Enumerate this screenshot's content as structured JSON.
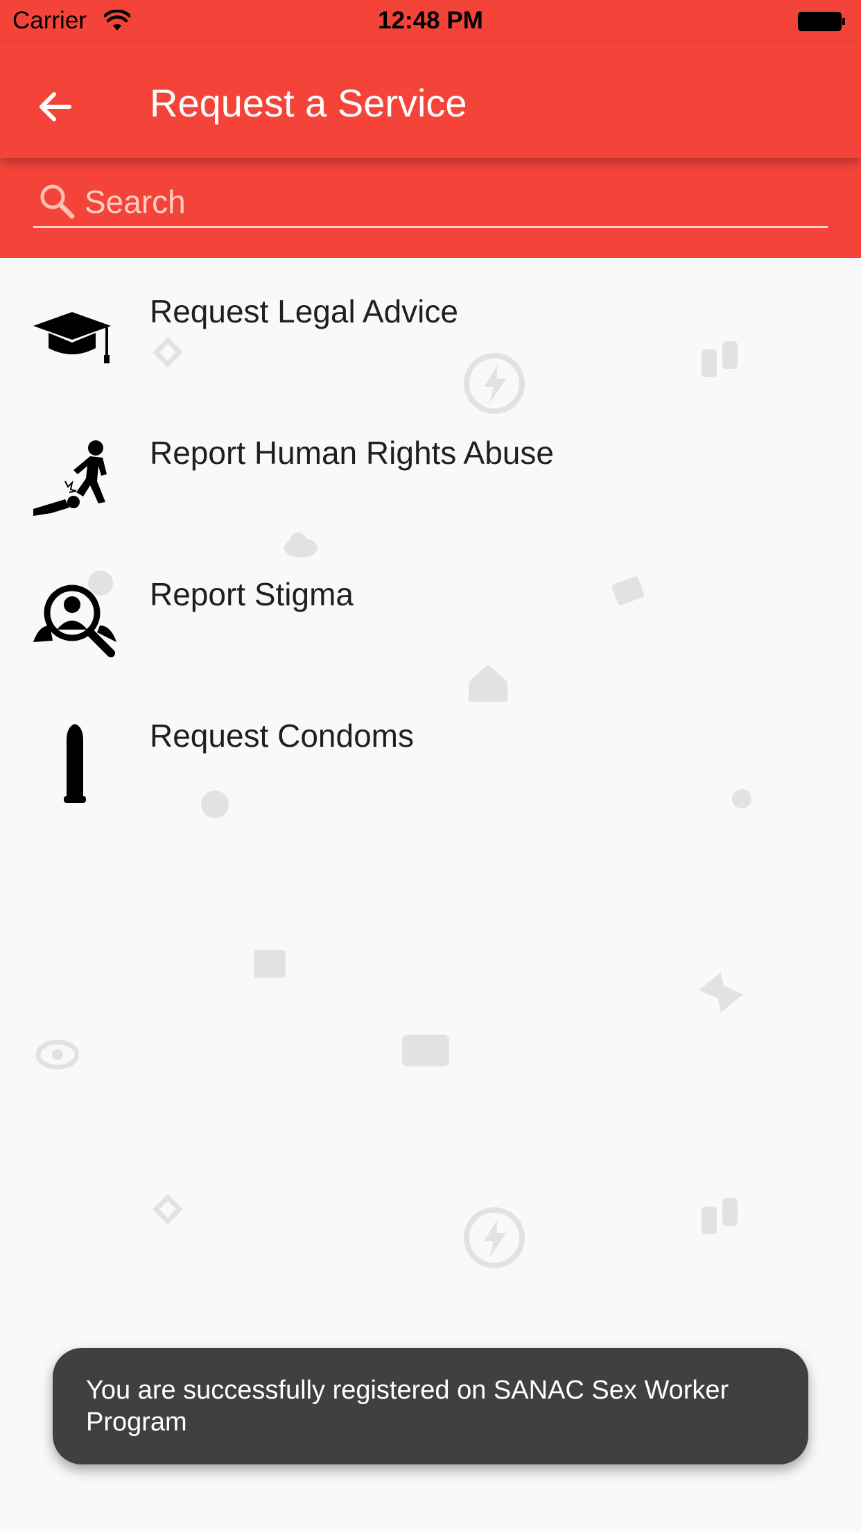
{
  "status_bar": {
    "carrier": "Carrier",
    "time": "12:48 PM"
  },
  "app_bar": {
    "title": "Request a Service",
    "back_icon": "arrow-back-icon"
  },
  "search": {
    "placeholder": "Search",
    "value": "",
    "icon": "search-icon"
  },
  "services": [
    {
      "label": "Request Legal Advice",
      "icon": "graduation-cap-icon"
    },
    {
      "label": "Report Human Rights Abuse",
      "icon": "abuse-figure-icon"
    },
    {
      "label": "Report Stigma",
      "icon": "stigma-magnifier-icon"
    },
    {
      "label": "Request Condoms",
      "icon": "condom-icon"
    }
  ],
  "toast": {
    "message": "You are successfully registered on SANAC Sex Worker Program"
  },
  "colors": {
    "primary": "#f4443a",
    "background": "#f9f9f9",
    "toast_bg": "#404040",
    "watermark": "#e2e2e2"
  }
}
